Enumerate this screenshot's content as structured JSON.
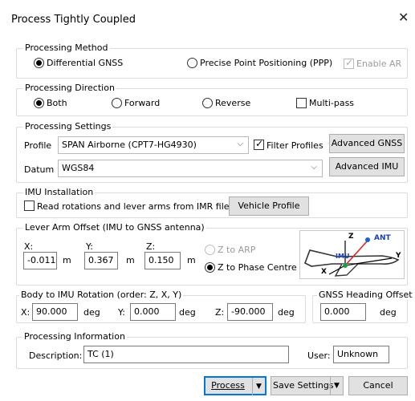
{
  "window": {
    "title": "Process Tightly Coupled"
  },
  "processing_method": {
    "title": "Processing Method",
    "options": [
      "Differential GNSS",
      "Precise Point Positioning (PPP)"
    ],
    "selected": "Differential GNSS",
    "enable_ar_label": "Enable AR",
    "enable_ar_checked": true,
    "enable_ar_disabled": true
  },
  "processing_direction": {
    "title": "Processing Direction",
    "options": [
      "Both",
      "Forward",
      "Reverse"
    ],
    "selected": "Both",
    "multipass_label": "Multi-pass",
    "multipass_checked": false
  },
  "processing_settings": {
    "title": "Processing Settings",
    "profile_label": "Profile",
    "profile_value": "SPAN Airborne (CPT7-HG4930)",
    "filter_profiles_label": "Filter Profiles",
    "filter_profiles_checked": true,
    "advanced_gnss_label": "Advanced GNSS",
    "datum_label": "Datum",
    "datum_value": "WGS84",
    "advanced_imu_label": "Advanced IMU"
  },
  "imu_installation": {
    "title": "IMU Installation",
    "read_rotations_label": "Read rotations and lever arms from IMR file",
    "read_rotations_checked": false,
    "vehicle_profile_label": "Vehicle Profile"
  },
  "lever_arm": {
    "title": "Lever Arm Offset (IMU to GNSS antenna)",
    "x_label": "X:",
    "x_value": "-0.011",
    "x_unit": "m",
    "y_label": "Y:",
    "y_value": "0.367",
    "y_unit": "m",
    "z_label": "Z:",
    "z_value": "0.150",
    "z_unit": "m",
    "z_to_arp_label": "Z to ARP",
    "z_to_phase_label": "Z to Phase Centre",
    "z_reference_selected": "Z to Phase Centre",
    "diagram": {
      "z": "Z",
      "ant": "ANT",
      "imu": "IMU",
      "y": "Y",
      "x": "X"
    }
  },
  "body_rotation": {
    "title": "Body to IMU Rotation (order: Z, X, Y)",
    "x_label": "X:",
    "x_value": "90.000",
    "x_unit": "deg",
    "y_label": "Y:",
    "y_value": "0.000",
    "y_unit": "deg",
    "z_label": "Z:",
    "z_value": "-90.000",
    "z_unit": "deg"
  },
  "gnss_heading": {
    "title": "GNSS Heading Offset",
    "value": "0.000",
    "unit": "deg"
  },
  "processing_info": {
    "title": "Processing Information",
    "description_label": "Description:",
    "description_value": "TC (1)",
    "user_label": "User:",
    "user_value": "Unknown"
  },
  "footer": {
    "process_label": "Process",
    "save_settings_label": "Save Settings",
    "cancel_label": "Cancel"
  }
}
